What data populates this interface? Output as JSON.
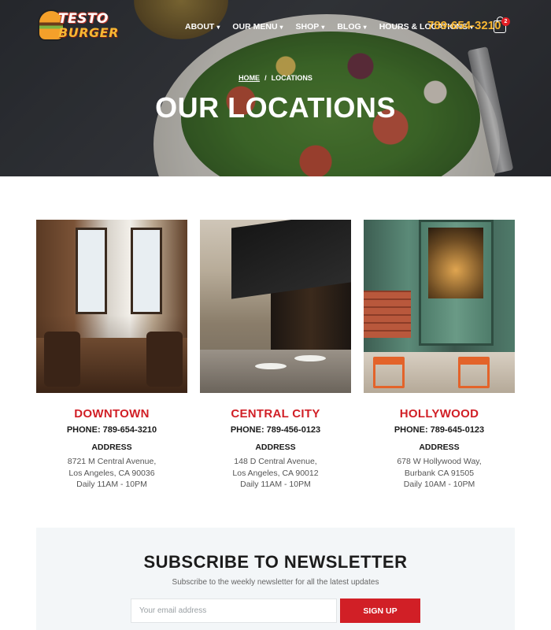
{
  "header": {
    "logo": {
      "line1": "TESTO",
      "line2": "BURGER"
    },
    "nav": [
      {
        "label": "ABOUT",
        "has_dropdown": true
      },
      {
        "label": "OUR MENU",
        "has_dropdown": true
      },
      {
        "label": "SHOP",
        "has_dropdown": true
      },
      {
        "label": "BLOG",
        "has_dropdown": true
      },
      {
        "label": "HOURS & LOCATIONS",
        "has_dropdown": true
      }
    ],
    "phone": "789-654-3210",
    "cart": {
      "icon": "shopping-bag-icon",
      "count": "2"
    }
  },
  "hero": {
    "breadcrumb": {
      "home": "HOME",
      "separator": "/",
      "current": "LOCATIONS"
    },
    "title": "OUR LOCATIONS"
  },
  "locations": [
    {
      "name": "DOWNTOWN",
      "phone": "PHONE: 789-654-3210",
      "address_heading": "ADDRESS",
      "address_line1": "8721 M Central Avenue,",
      "address_line2": "Los Angeles, CA 90036",
      "hours": "Daily 11AM - 10PM"
    },
    {
      "name": "CENTRAL CITY",
      "phone": "PHONE: 789-456-0123",
      "address_heading": "ADDRESS",
      "address_line1": "148 D Central Avenue,",
      "address_line2": "Los Angeles, CA 90012",
      "hours": "Daily 11AM - 10PM"
    },
    {
      "name": "HOLLYWOOD",
      "phone": "PHONE: 789-645-0123",
      "address_heading": "ADDRESS",
      "address_line1": "678 W Hollywood Way,",
      "address_line2": "Burbank CA 91505",
      "hours": "Daily 10AM - 10PM"
    }
  ],
  "newsletter": {
    "title": "SUBSCRIBE TO NEWSLETTER",
    "subtitle": "Subscribe to the weekly newsletter for all the latest updates",
    "email_placeholder": "Your email address",
    "email_value": "",
    "button_label": "SIGN UP"
  },
  "colors": {
    "accent_red": "#d11f26",
    "phone_yellow": "#f7b733",
    "newsletter_bg": "#f3f6f8"
  }
}
